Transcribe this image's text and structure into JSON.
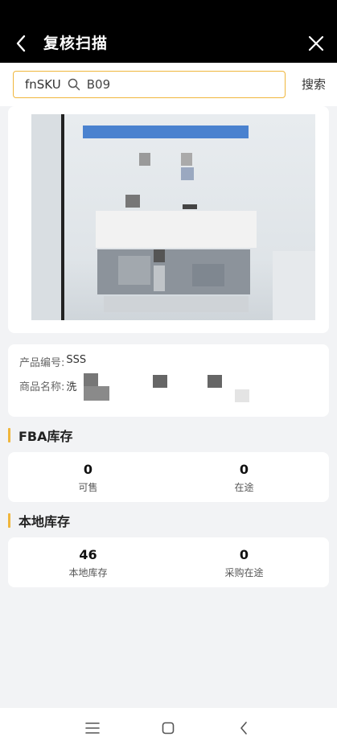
{
  "header": {
    "title": "复核扫描"
  },
  "search": {
    "type_label": "fnSKU",
    "value": "B09",
    "button_label": "搜索"
  },
  "product_info": {
    "code_label": "产品编号:",
    "code_value": "SSS",
    "name_label": "商品名称:",
    "name_value": "洗"
  },
  "fba_stock": {
    "title": "FBA库存",
    "available_value": "0",
    "available_label": "可售",
    "in_transit_value": "0",
    "in_transit_label": "在途"
  },
  "local_stock": {
    "title": "本地库存",
    "local_value": "46",
    "local_label": "本地库存",
    "purchase_transit_value": "0",
    "purchase_transit_label": "采购在途"
  },
  "colors": {
    "accent": "#f0b63c",
    "header_bg": "#000000",
    "page_bg": "#f2f3f5"
  },
  "icons": [
    "back-arrow-icon",
    "close-icon",
    "search-icon",
    "menu-icon",
    "home-icon",
    "nav-back-icon"
  ]
}
